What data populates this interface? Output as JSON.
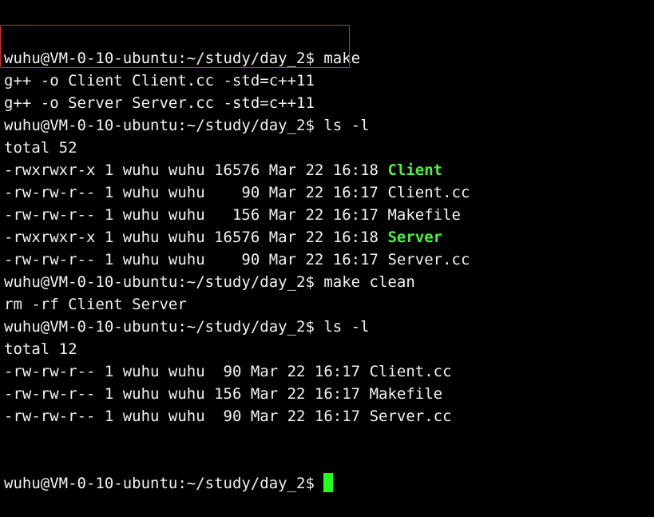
{
  "prompt": "wuhu@VM-0-10-ubuntu:~/study/day_2$ ",
  "lines": [
    {
      "kind": "prompt",
      "text": "wuhu@VM-0-10-ubuntu:~/study/day_2$ make"
    },
    {
      "kind": "output",
      "text": "g++ -o Client Client.cc -std=c++11"
    },
    {
      "kind": "output",
      "text": "g++ -o Server Server.cc -std=c++11"
    },
    {
      "kind": "prompt",
      "text": "wuhu@VM-0-10-ubuntu:~/study/day_2$ ls -l"
    },
    {
      "kind": "output",
      "text": "total 52"
    },
    {
      "kind": "file",
      "meta": "-rwxrwxr-x 1 wuhu wuhu 16576 Mar 22 16:18 ",
      "name": "Client",
      "exec": true
    },
    {
      "kind": "file",
      "meta": "-rw-rw-r-- 1 wuhu wuhu    90 Mar 22 16:17 ",
      "name": "Client.cc",
      "exec": false
    },
    {
      "kind": "file",
      "meta": "-rw-rw-r-- 1 wuhu wuhu   156 Mar 22 16:17 ",
      "name": "Makefile",
      "exec": false
    },
    {
      "kind": "file",
      "meta": "-rwxrwxr-x 1 wuhu wuhu 16576 Mar 22 16:18 ",
      "name": "Server",
      "exec": true
    },
    {
      "kind": "file",
      "meta": "-rw-rw-r-- 1 wuhu wuhu    90 Mar 22 16:17 ",
      "name": "Server.cc",
      "exec": false
    },
    {
      "kind": "prompt",
      "text": "wuhu@VM-0-10-ubuntu:~/study/day_2$ make clean"
    },
    {
      "kind": "output",
      "text": "rm -rf Client Server"
    },
    {
      "kind": "prompt",
      "text": "wuhu@VM-0-10-ubuntu:~/study/day_2$ ls -l"
    },
    {
      "kind": "output",
      "text": "total 12"
    },
    {
      "kind": "file",
      "meta": "-rw-rw-r-- 1 wuhu wuhu  90 Mar 22 16:17 ",
      "name": "Client.cc",
      "exec": false
    },
    {
      "kind": "file",
      "meta": "-rw-rw-r-- 1 wuhu wuhu 156 Mar 22 16:17 ",
      "name": "Makefile",
      "exec": false
    },
    {
      "kind": "file",
      "meta": "-rw-rw-r-- 1 wuhu wuhu  90 Mar 22 16:17 ",
      "name": "Server.cc",
      "exec": false
    }
  ],
  "colors": {
    "background": "#000000",
    "text": "#f2f2f2",
    "executable": "#4ef044",
    "highlight_border": "#d0302f",
    "cursor": "#22ff22"
  }
}
